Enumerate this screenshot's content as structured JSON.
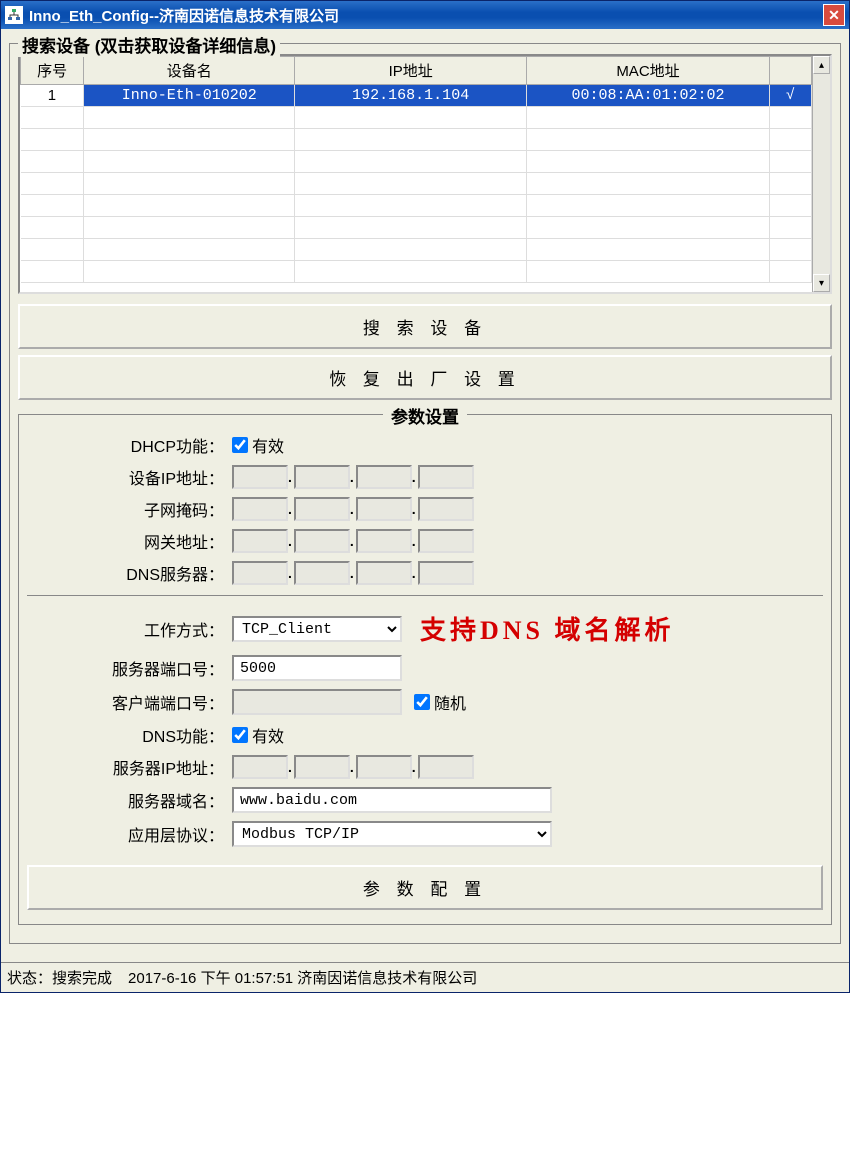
{
  "titlebar": {
    "title": "Inno_Eth_Config--济南因诺信息技术有限公司"
  },
  "search_group": {
    "title": "搜索设备 (双击获取设备详细信息)",
    "columns": {
      "num": "序号",
      "name": "设备名",
      "ip": "IP地址",
      "mac": "MAC地址"
    },
    "rows": [
      {
        "num": "1",
        "name": "Inno-Eth-010202",
        "ip": "192.168.1.104",
        "mac": "00:08:AA:01:02:02",
        "check": "√"
      }
    ]
  },
  "buttons": {
    "search": "搜 索 设 备",
    "factory_reset": "恢 复 出 厂 设 置",
    "apply_params": "参 数 配 置"
  },
  "params": {
    "title": "参数设置",
    "dhcp_label": "DHCP功能：",
    "dhcp_valid": "有效",
    "device_ip_label": "设备IP地址：",
    "subnet_label": "子网掩码：",
    "gateway_label": "网关地址：",
    "dns_server_label": "DNS服务器：",
    "work_mode_label": "工作方式：",
    "work_mode_value": "TCP_Client",
    "server_port_label": "服务器端口号：",
    "server_port_value": "5000",
    "client_port_label": "客户端端口号：",
    "client_port_random": "随机",
    "dns_func_label": "DNS功能：",
    "dns_func_valid": "有效",
    "server_ip_label": "服务器IP地址：",
    "server_domain_label": "服务器域名：",
    "server_domain_value": "www.baidu.com",
    "app_proto_label": "应用层协议：",
    "app_proto_value": "Modbus TCP/IP",
    "red_note": "支持DNS 域名解析"
  },
  "status": {
    "state": "状态：搜索完成",
    "time": "2017-6-16   下午 01:57:51 济南因诺信息技术有限公司"
  }
}
